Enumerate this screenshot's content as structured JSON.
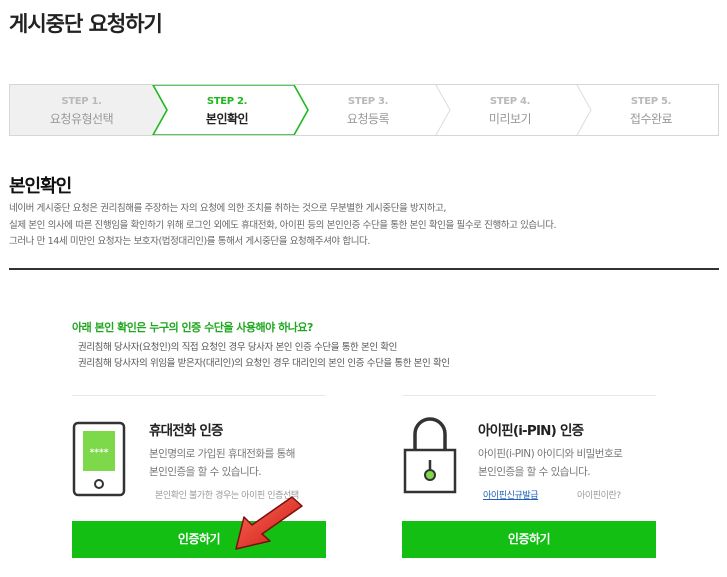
{
  "page": {
    "title": "게시중단 요청하기"
  },
  "stepper": {
    "steps": [
      {
        "num": "STEP 1.",
        "label": "요청유형선택",
        "active": false
      },
      {
        "num": "STEP 2.",
        "label": "본인확인",
        "active": true
      },
      {
        "num": "STEP 3.",
        "label": "요청등록",
        "active": false
      },
      {
        "num": "STEP 4.",
        "label": "미리보기",
        "active": false
      },
      {
        "num": "STEP 5.",
        "label": "접수완료",
        "active": false
      }
    ],
    "active_color": "#1fb81f"
  },
  "verify": {
    "title": "본인확인",
    "intro": [
      "네이버 게시중단 요청은 권리침해를 주장하는 자의 요청에 의한 조치를 취하는 것으로 무분별한 게시중단을 방지하고,",
      "실제 본인 의사에 따른 진행임을 확인하기 위해 로그인 외에도 휴대전화, 아이핀 등의 본인인증 수단을 통한 본인 확인을 필수로 진행하고 있습니다.",
      "그러나 만 14세 미만인 요청자는 보호자(법정대리인)를 통해서 게시중단을 요청해주셔야 합니다."
    ]
  },
  "notice": {
    "question": "아래 본인 확인은 누구의 인증 수단을 사용해야 하나요?",
    "items": [
      "권리침해 당사자(요청인)의 직접 요청인 경우 당사자 본인 인증 수단을 통한 본인 확인",
      "권리침해 당사자의 위임을 받은자(대리인)의 요청인 경우 대리인의 본인 인증 수단을 통한 본인 확인"
    ]
  },
  "methods": {
    "phone": {
      "title": "휴대전화 인증",
      "desc": [
        "본인명의로 가입된 휴대전화를 통해",
        "본인인증을 할 수 있습니다."
      ],
      "note": "본인확인 불가한 경우는 아이핀 인증선택",
      "screen_text": "****",
      "button": "인증하기"
    },
    "ipin": {
      "title": "아이핀(i-PIN) 인증",
      "desc": [
        "아이핀(i-PIN) 아이디와 비밀번호로",
        "본인인증을 할 수 있습니다."
      ],
      "link_signup": "아이핀신규발급",
      "link_what": "아이핀이란?",
      "button": "인증하기"
    }
  },
  "colors": {
    "accent": "#13bf13",
    "arrow": "#e0241c"
  }
}
